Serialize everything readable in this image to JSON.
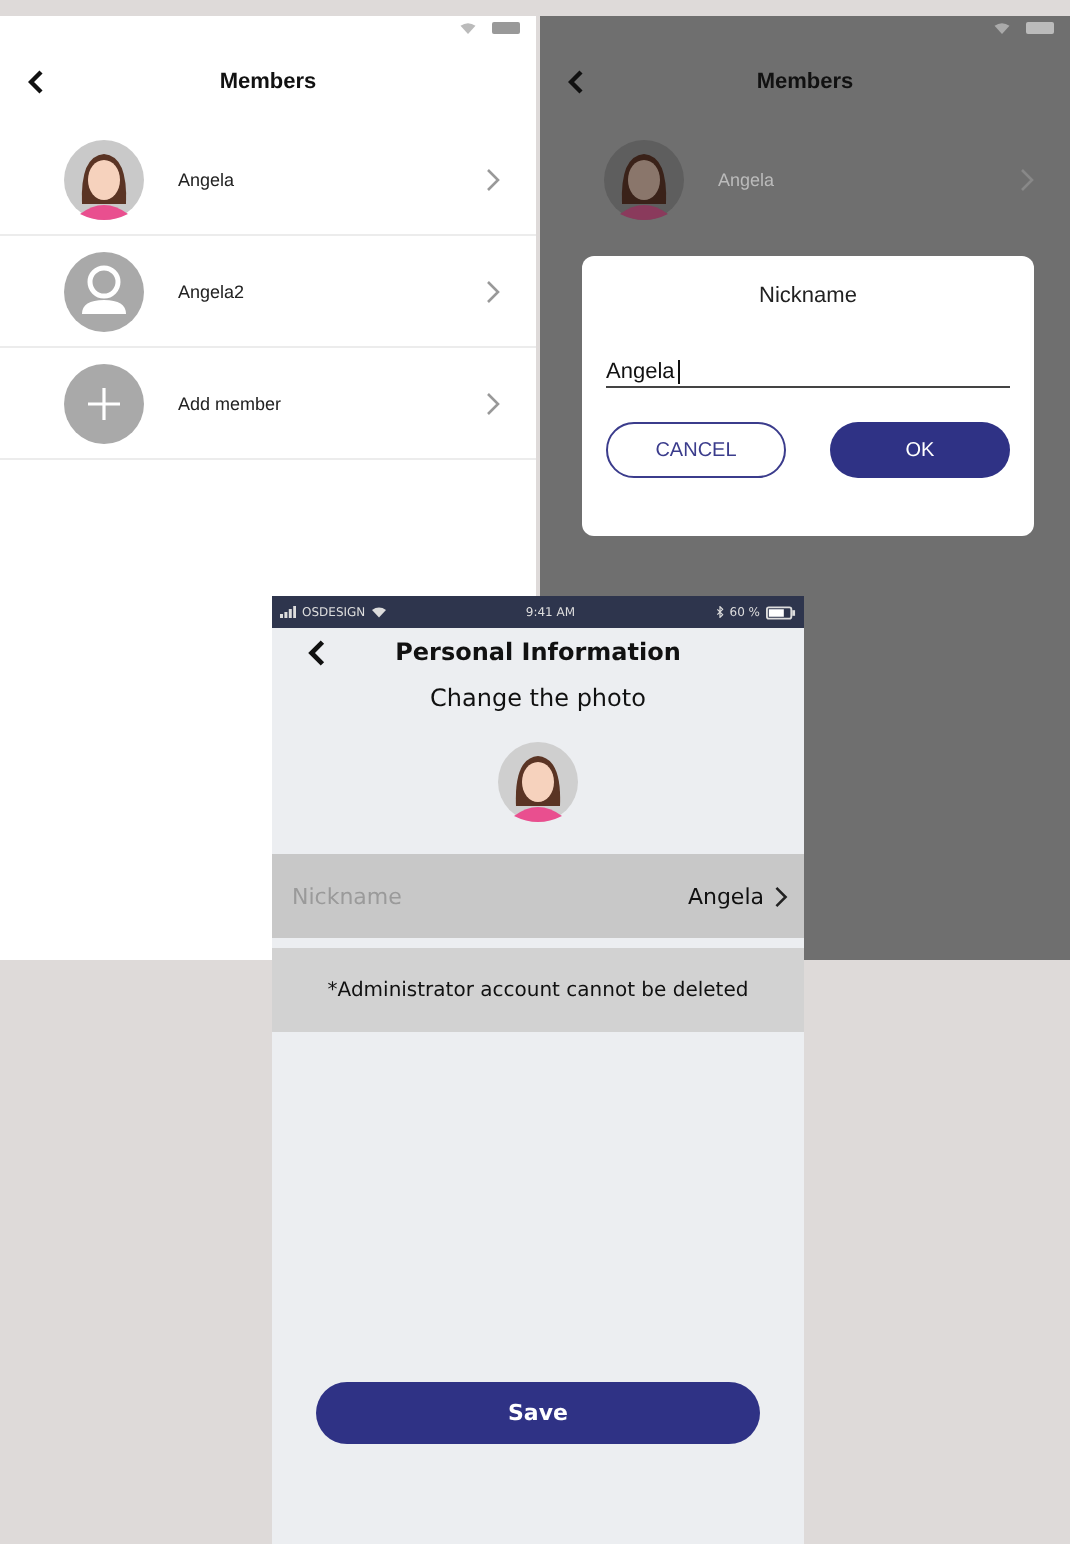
{
  "members_screen": {
    "title": "Members",
    "members": [
      {
        "name": "Angela",
        "kind": "photo"
      },
      {
        "name": "Angela2",
        "kind": "placeholder"
      },
      {
        "name": "Add member",
        "kind": "add"
      }
    ]
  },
  "dialog_screen": {
    "title": "Members",
    "members": [
      {
        "name": "Angela",
        "kind": "photo"
      }
    ],
    "dialog": {
      "title": "Nickname",
      "value": "Angela",
      "buttons": [
        {
          "label": "CANCEL",
          "kind": "outline"
        },
        {
          "label": "OK",
          "kind": "primary"
        }
      ]
    }
  },
  "profile_screen": {
    "status_bar": {
      "carrier": "OSDESIGN",
      "time": "9:41 AM",
      "battery": "60 %"
    },
    "title": "Personal Information",
    "photo_label": "Change the photo",
    "fields": [
      {
        "label": "Nickname",
        "value": "Angela"
      }
    ],
    "note": "*Administrator account cannot be deleted",
    "save": "Save"
  }
}
